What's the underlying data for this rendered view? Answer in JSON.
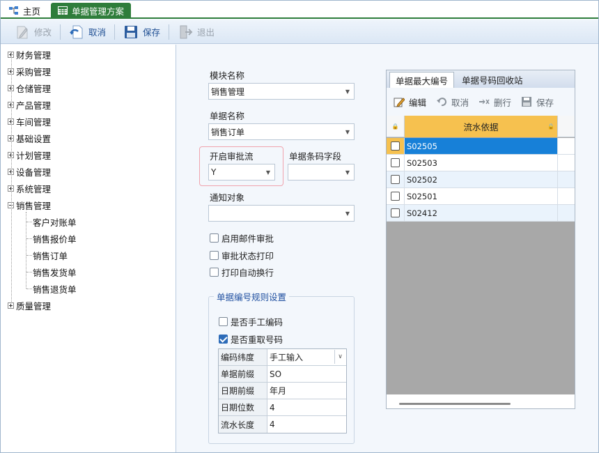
{
  "tabs": {
    "home": "主页",
    "main": "单据管理方案"
  },
  "toolbar": {
    "modify": "修改",
    "cancel": "取消",
    "save": "保存",
    "exit": "退出"
  },
  "tree": {
    "nodes": [
      "财务管理",
      "采购管理",
      "仓储管理",
      "产品管理",
      "车间管理",
      "基础设置",
      "计划管理",
      "设备管理",
      "系统管理",
      "销售管理"
    ],
    "sales_children": [
      "客户对账单",
      "销售报价单",
      "销售订单",
      "销售发货单",
      "销售退货单"
    ],
    "last": "质量管理"
  },
  "form": {
    "module_label": "模块名称",
    "module_value": "销售管理",
    "doc_label": "单据名称",
    "doc_value": "销售订单",
    "approval_label": "开启审批流",
    "approval_value": "Y",
    "barcode_label": "单据条码字段",
    "barcode_value": "",
    "notify_label": "通知对象",
    "notify_value": "",
    "mail_approval": "启用邮件审批",
    "approval_print": "审批状态打印",
    "print_wrap": "打印自动换行",
    "group_title": "单据编号规则设置",
    "manual_code": "是否手工编码",
    "reuse_code": "是否重取号码",
    "props": [
      {
        "key": "编码纬度",
        "value": "手工输入"
      },
      {
        "key": "单据前缀",
        "value": "SO"
      },
      {
        "key": "日期前缀",
        "value": "年月"
      },
      {
        "key": "日期位数",
        "value": "4"
      },
      {
        "key": "流水长度",
        "value": "4"
      }
    ]
  },
  "right_panel": {
    "tab_max": "单据最大编号",
    "tab_recycle": "单据号码回收站",
    "edit": "编辑",
    "cancel": "取消",
    "delete_row": "删行",
    "save": "保存",
    "column": "流水依据",
    "rows": [
      "S02505",
      "S02503",
      "S02502",
      "S02501",
      "S02412"
    ]
  },
  "colors": {
    "tab_green": "#2e7d3b",
    "header_orange": "#f6c14f",
    "selected_blue": "#1780d8",
    "highlight_pink": "#f0a3ad"
  }
}
